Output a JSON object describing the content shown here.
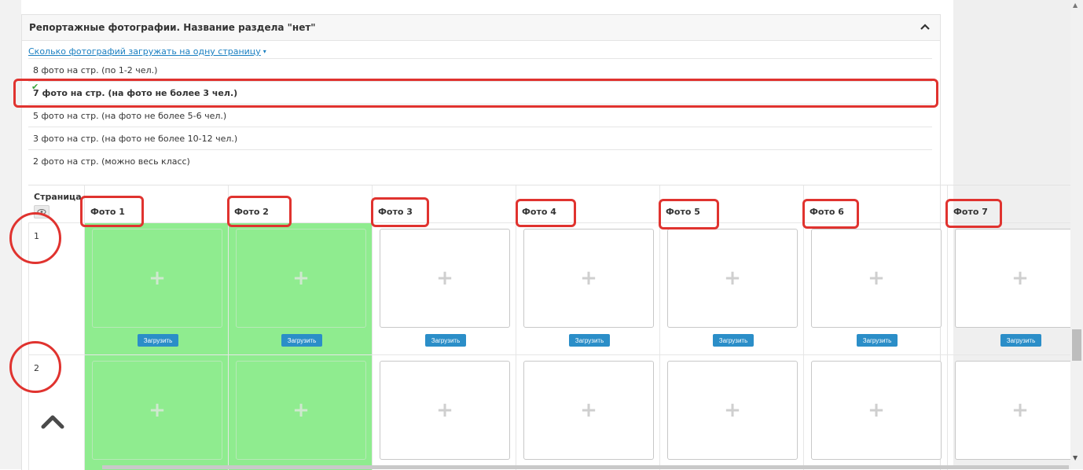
{
  "section": {
    "title": "Репортажные фотографии. Название раздела \"нет\"",
    "toggle_icon": "chevron-up-icon"
  },
  "per_page": {
    "link_label": "Сколько фотографий загружать на одну страницу",
    "caret": "▾",
    "options": [
      {
        "label": "8 фото на стр. (по 1-2 чел.)",
        "selected": false
      },
      {
        "label": "7 фото на стр. (на фото не более 3 чел.)",
        "selected": true
      },
      {
        "label": "5 фото на стр. (на фото не более 5-6 чел.)",
        "selected": false
      },
      {
        "label": "3 фото на стр. (на фото не более 10-12 чел.)",
        "selected": false
      },
      {
        "label": "2 фото на стр. (можно весь класс)",
        "selected": false
      }
    ],
    "check_icon": "✔"
  },
  "grid": {
    "page_header": "Страница",
    "columns": [
      "Фото 1",
      "Фото 2",
      "Фото 3",
      "Фото 4",
      "Фото 5",
      "Фото 6",
      "Фото 7"
    ],
    "rows": [
      {
        "page": "1",
        "filled": [
          true,
          true,
          false,
          false,
          false,
          false,
          false
        ]
      },
      {
        "page": "2",
        "filled": [
          true,
          true,
          false,
          false,
          false,
          false,
          false
        ]
      }
    ],
    "upload_label": "Загрузить",
    "plus_symbol": "+"
  },
  "colors": {
    "filled_cell": "#8fec8f",
    "annotation": "#e0332f",
    "upload_button": "#2b8ec8",
    "link": "#1a7fc1",
    "check": "#3aa33a"
  }
}
